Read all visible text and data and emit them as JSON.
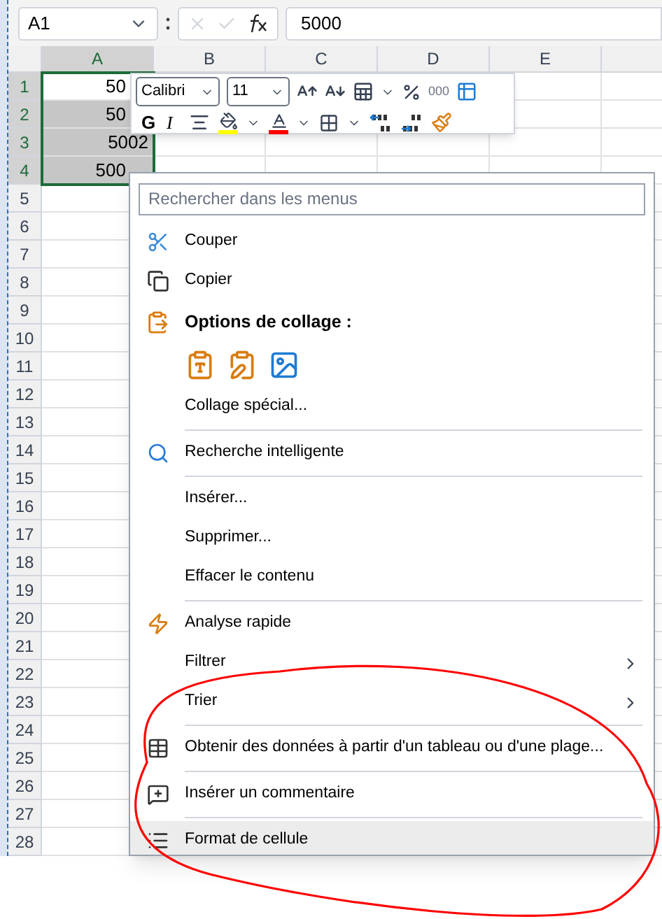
{
  "name_box": {
    "value": "A1"
  },
  "formula_bar": {
    "value": "5000"
  },
  "columns": [
    {
      "label": "A",
      "selected": true
    },
    {
      "label": "B",
      "selected": false
    },
    {
      "label": "C",
      "selected": false
    },
    {
      "label": "D",
      "selected": false
    },
    {
      "label": "E",
      "selected": false
    }
  ],
  "rows": [
    {
      "label": "1",
      "selected": true,
      "cell": "50"
    },
    {
      "label": "2",
      "selected": true,
      "cell": "50"
    },
    {
      "label": "3",
      "selected": true,
      "cell": "5002"
    },
    {
      "label": "4",
      "selected": true,
      "cell": "500"
    },
    {
      "label": "5",
      "selected": false
    },
    {
      "label": "6",
      "selected": false
    },
    {
      "label": "7",
      "selected": false
    },
    {
      "label": "8",
      "selected": false
    },
    {
      "label": "9",
      "selected": false
    },
    {
      "label": "10",
      "selected": false
    },
    {
      "label": "11",
      "selected": false
    },
    {
      "label": "12",
      "selected": false
    },
    {
      "label": "13",
      "selected": false
    },
    {
      "label": "14",
      "selected": false
    },
    {
      "label": "15",
      "selected": false
    },
    {
      "label": "16",
      "selected": false
    },
    {
      "label": "17",
      "selected": false
    },
    {
      "label": "18",
      "selected": false
    },
    {
      "label": "19",
      "selected": false
    },
    {
      "label": "20",
      "selected": false
    },
    {
      "label": "21",
      "selected": false
    },
    {
      "label": "22",
      "selected": false
    },
    {
      "label": "23",
      "selected": false
    },
    {
      "label": "24",
      "selected": false
    },
    {
      "label": "25",
      "selected": false
    },
    {
      "label": "26",
      "selected": false
    },
    {
      "label": "27",
      "selected": false
    },
    {
      "label": "28",
      "selected": false
    }
  ],
  "mini_toolbar": {
    "font": "Calibri",
    "size": "11",
    "bold": "G",
    "italic": "I",
    "thousands": "000"
  },
  "context_menu": {
    "search": {
      "placeholder": "Rechercher dans les menus"
    },
    "items": [
      {
        "kind": "item",
        "label": "Couper",
        "submenu": false,
        "highlighted": false
      },
      {
        "kind": "item",
        "label": "Copier",
        "submenu": false,
        "highlighted": false
      },
      {
        "kind": "header",
        "label": "Options de collage :"
      },
      {
        "kind": "paste_options"
      },
      {
        "kind": "item",
        "label": "Collage spécial...",
        "submenu": false,
        "highlighted": false
      },
      {
        "kind": "separator"
      },
      {
        "kind": "item",
        "label": "Recherche intelligente",
        "submenu": false,
        "highlighted": false
      },
      {
        "kind": "separator"
      },
      {
        "kind": "item",
        "label": "Insérer...",
        "submenu": false,
        "highlighted": false
      },
      {
        "kind": "item",
        "label": "Supprimer...",
        "submenu": false,
        "highlighted": false
      },
      {
        "kind": "item",
        "label": "Effacer le contenu",
        "submenu": false,
        "highlighted": false
      },
      {
        "kind": "separator"
      },
      {
        "kind": "item",
        "label": "Analyse rapide",
        "submenu": false,
        "highlighted": false
      },
      {
        "kind": "item",
        "label": "Filtrer",
        "submenu": true,
        "highlighted": false
      },
      {
        "kind": "item",
        "label": "Trier",
        "submenu": true,
        "highlighted": false
      },
      {
        "kind": "separator"
      },
      {
        "kind": "item",
        "label": "Obtenir des données à partir d'un tableau ou d'une plage...",
        "submenu": false,
        "highlighted": false
      },
      {
        "kind": "separator"
      },
      {
        "kind": "item",
        "label": "Insérer un commentaire",
        "submenu": false,
        "highlighted": false
      },
      {
        "kind": "separator"
      },
      {
        "kind": "item",
        "label": "Format de cellule",
        "submenu": false,
        "highlighted": true
      }
    ]
  },
  "annotation": {
    "kind": "ellipse",
    "color": "#ff0000"
  }
}
